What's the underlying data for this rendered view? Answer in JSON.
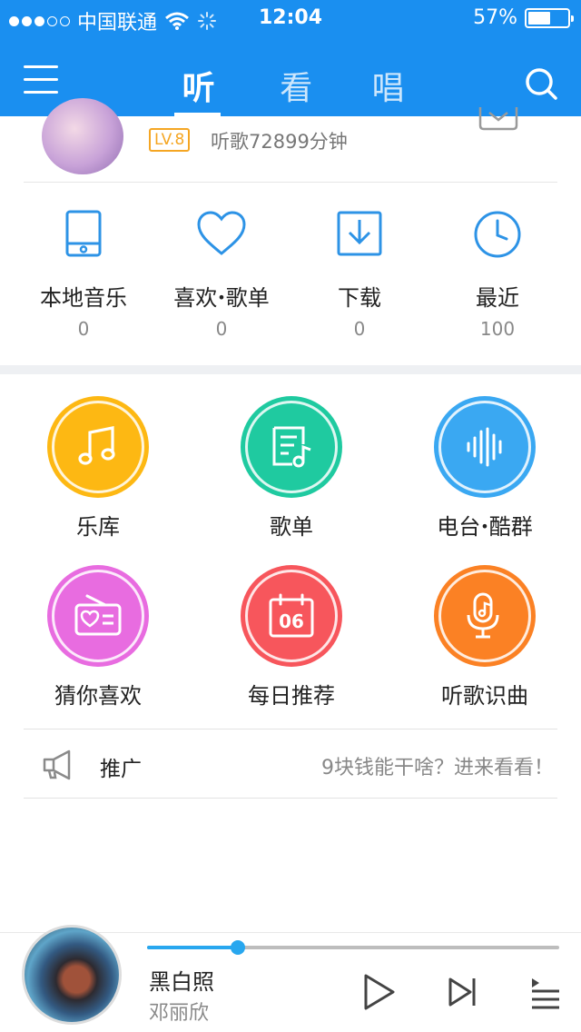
{
  "status_bar": {
    "carrier": "中国联通",
    "time": "12:04",
    "battery_text": "57%",
    "battery_level": 0.57,
    "signal_bars_filled": 3,
    "signal_bars_total": 5
  },
  "header": {
    "tabs": [
      {
        "label": "听",
        "active": true
      },
      {
        "label": "看",
        "active": false
      },
      {
        "label": "唱",
        "active": false
      }
    ],
    "colors": {
      "bar": "#1a8ff0"
    }
  },
  "profile": {
    "level": "LV.8",
    "listen_time": "听歌72899分钟"
  },
  "quick_items": [
    {
      "label": "本地音乐",
      "count": "0",
      "icon": "phone-icon"
    },
    {
      "label": "喜欢",
      "label_b": "歌单",
      "count": "0",
      "icon": "heart-icon"
    },
    {
      "label": "下载",
      "count": "0",
      "icon": "download-icon"
    },
    {
      "label": "最近",
      "count": "100",
      "icon": "clock-icon"
    }
  ],
  "features": [
    {
      "label": "乐库",
      "icon": "music-note-icon",
      "color": "#fdb813"
    },
    {
      "label": "歌单",
      "icon": "playlist-icon",
      "color": "#1fcaa0"
    },
    {
      "label": "电台",
      "label_b": "酷群",
      "icon": "sound-wave-icon",
      "color": "#3aa8f2"
    },
    {
      "label": "猜你喜欢",
      "icon": "radio-heart-icon",
      "color": "#e86ce0"
    },
    {
      "label": "每日推荐",
      "icon": "calendar-icon",
      "color": "#f7565c",
      "day": "06"
    },
    {
      "label": "听歌识曲",
      "icon": "microphone-icon",
      "color": "#fb8124"
    }
  ],
  "promo": {
    "title": "推广",
    "text": "9块钱能干啥？进来看看！"
  },
  "player": {
    "song": "黑白照",
    "artist": "邓丽欣",
    "progress": 0.22
  }
}
